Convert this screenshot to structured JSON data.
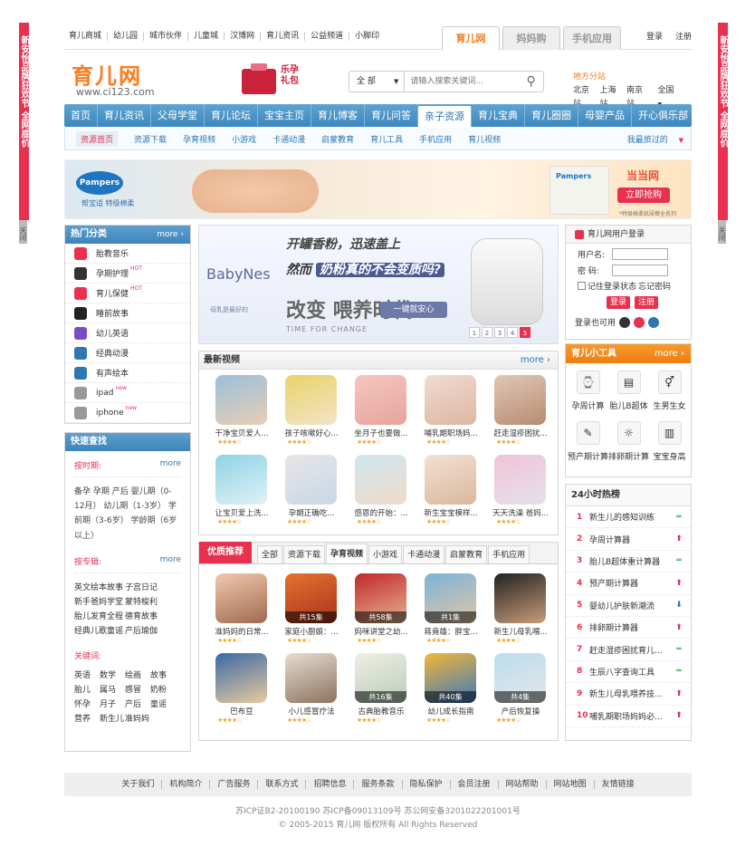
{
  "side_ad": {
    "left_text": "新安怡品牌狂欢节 全网底价",
    "right_text": "新安怡品牌狂欢节 全网底价",
    "close": "关闭"
  },
  "topbar": {
    "links": [
      "育儿商城",
      "幼儿园",
      "城市伙伴",
      "儿童城",
      "汉博网",
      "育儿资讯",
      "公益频道",
      "小脚印"
    ],
    "site_tabs": [
      "育儿网",
      "妈妈购",
      "手机应用"
    ],
    "login": "登录",
    "register": "注册"
  },
  "header": {
    "logo": "育儿网",
    "url": "www.ci123.com",
    "promo": "乐孕礼包",
    "search_select": "全 部",
    "search_placeholder": "请输入搜索关键词...",
    "region_title": "地方分站",
    "cities": [
      "北京站",
      "上海站",
      "南京站",
      "全国"
    ]
  },
  "nav": {
    "items": [
      "首页",
      "育儿资讯",
      "父母学堂",
      "育儿论坛",
      "宝宝主页",
      "育儿博客",
      "育儿问答",
      "亲子资源",
      "育儿宝典",
      "育儿圈圈",
      "母婴产品",
      "开心俱乐部"
    ],
    "active": "亲子资源"
  },
  "subnav": {
    "items": [
      "资源首页",
      "资源下载",
      "孕育视频",
      "小游戏",
      "卡通动漫",
      "启蒙教育",
      "育儿工具",
      "手机应用",
      "育儿视频"
    ],
    "mine": "我最旅过的"
  },
  "banner": {
    "brand": "Pampers",
    "brand_sub": "帮宝适 特级棉柔",
    "shop": "当当网",
    "button": "立即抢购",
    "note": "*特级棉柔纸尿裤全系列"
  },
  "hot_categories": {
    "title": "热门分类",
    "more": "more",
    "items": [
      {
        "label": "胎教音乐",
        "hot": "",
        "color": "#e8304f"
      },
      {
        "label": "孕期护理",
        "hot": "HOT",
        "color": "#333"
      },
      {
        "label": "育儿保健",
        "hot": "HOT",
        "color": "#e8304f"
      },
      {
        "label": "睡前故事",
        "hot": "",
        "color": "#222"
      },
      {
        "label": "幼儿英语",
        "hot": "",
        "color": "#7a4cc4"
      },
      {
        "label": "经典动漫",
        "hot": "",
        "color": "#2d78b3"
      },
      {
        "label": "有声绘本",
        "hot": "",
        "color": "#2d78b3"
      },
      {
        "label": "ipad",
        "hot": "new",
        "color": "#999"
      },
      {
        "label": "iphone",
        "hot": "new",
        "color": "#999"
      }
    ]
  },
  "quick": {
    "title": "快速查找",
    "by_time": "按时期:",
    "more": "more",
    "time_text": "备孕  孕期  产后 婴儿期（0-12月）  幼儿期（1-3岁）  学前期（3-6岁）  学龄期（6岁以上）",
    "by_topic": "按专辑:",
    "topics": [
      "英文绘本故事",
      "子宫日记",
      "新手爸妈学堂",
      "蒙特梭利",
      "胎儿发育全程",
      "德育故事",
      "经典儿歌童谣",
      "产后瑜伽"
    ],
    "by_keyword": "关键词:",
    "keywords": [
      "英语",
      "数学",
      "绘画",
      "故事",
      "胎儿",
      "属马",
      "感冒",
      "奶粉",
      "怀孕",
      "月子",
      "产后",
      "童谣",
      "营养",
      "新生儿",
      "准妈妈"
    ]
  },
  "mid_ad": {
    "line1": "开罐香粉，迅速盖上",
    "line2_a": "然而",
    "line2_b": "奶粉真的不会变质吗?",
    "brand": "BabyNes",
    "brand_sub": "母乳是最好的",
    "change": "改变 喂养时代",
    "change_sub": "TIME FOR CHANGE",
    "button": "一键就安心",
    "pages": [
      "1",
      "2",
      "3",
      "4",
      "5"
    ]
  },
  "videos": {
    "title": "最新视频",
    "more": "more",
    "items": [
      {
        "caption": "干净宝贝爱人...",
        "c1": "#9ac0db",
        "c2": "#e9cdb4"
      },
      {
        "caption": "孩子咳嗽好心...",
        "c1": "#e8d36a",
        "c2": "#f2e4c8"
      },
      {
        "caption": "坐月子也要做...",
        "c1": "#f4c7c0",
        "c2": "#e7a49c"
      },
      {
        "caption": "哺乳期职场妈...",
        "c1": "#f0dcd0",
        "c2": "#ddb6a3"
      },
      {
        "caption": "赶走湿疹困扰...",
        "c1": "#dfc8b6",
        "c2": "#b98b72"
      },
      {
        "caption": "让宝贝爱上洗...",
        "c1": "#8ed3e6",
        "c2": "#e0f1f5"
      },
      {
        "caption": "孕期正确吃...",
        "c1": "#e6e6e6",
        "c2": "#c9d7e6"
      },
      {
        "caption": "感恩的开始：...",
        "c1": "#cfe7f0",
        "c2": "#eedbc8"
      },
      {
        "caption": "新生宝宝模样...",
        "c1": "#f3e1d3",
        "c2": "#d9b89c"
      },
      {
        "caption": "天天洗澡 爸妈...",
        "c1": "#f2c3d6",
        "c2": "#e4e1ec"
      }
    ]
  },
  "recommend": {
    "label": "优质推荐",
    "tabs": [
      "全部",
      "资源下载",
      "孕育视频",
      "小游戏",
      "卡通动漫",
      "启蒙教育",
      "手机应用"
    ],
    "active_tab": "孕育视频",
    "items": [
      {
        "caption": "准妈妈的日常...",
        "ep": "",
        "c1": "#f1c9b0",
        "c2": "#a06a4f"
      },
      {
        "caption": "家庭小厨娘：...",
        "ep": "共15集",
        "c1": "#e4732f",
        "c2": "#a8331b"
      },
      {
        "caption": "妈咪讲堂之幼...",
        "ep": "共58集",
        "c1": "#c0282d",
        "c2": "#e4b48e"
      },
      {
        "caption": "蒋竟雄：胖宝...",
        "ep": "共1集",
        "c1": "#7bb4d6",
        "c2": "#dfc6a9"
      },
      {
        "caption": "新生儿母乳喂...",
        "ep": "",
        "c1": "#222",
        "c2": "#c89d7a"
      },
      {
        "caption": "巴布豆",
        "ep": "",
        "c1": "#3a6aa6",
        "c2": "#e8ca9e"
      },
      {
        "caption": "小儿感冒疗法",
        "ep": "",
        "c1": "#e6ddd2",
        "c2": "#8d735e"
      },
      {
        "caption": "古典胎教音乐",
        "ep": "共16集",
        "c1": "#f0eee6",
        "c2": "#b8cdb7"
      },
      {
        "caption": "幼儿成长指南",
        "ep": "共40集",
        "c1": "#f2b736",
        "c2": "#3c78c0"
      },
      {
        "caption": "产后恢复操",
        "ep": "共4集",
        "c1": "#bcdcef",
        "c2": "#e3e7e8"
      }
    ]
  },
  "login": {
    "title": "育儿网用户登录",
    "username": "用户名:",
    "password": "密  码:",
    "remember": "记住登录状态",
    "forgot": "忘记密码",
    "login_btn": "登录",
    "register_btn": "注册",
    "social": "登录也可用"
  },
  "tools": {
    "title": "育儿小工具",
    "more": "more",
    "items": [
      {
        "label": "孕周计算",
        "icon": "⌚"
      },
      {
        "label": "胎儿B超体",
        "icon": "▤"
      },
      {
        "label": "生男生女",
        "icon": "⚥"
      },
      {
        "label": "预产期计算",
        "icon": "✎"
      },
      {
        "label": "排卵期计算",
        "icon": "☼"
      },
      {
        "label": "宝宝身高",
        "icon": "▥"
      }
    ]
  },
  "hot_list": {
    "title": "24小时热榜",
    "items": [
      {
        "n": "1",
        "t": "新生儿的感知训练",
        "trend": "eq"
      },
      {
        "n": "2",
        "t": "孕周计算器",
        "trend": "up"
      },
      {
        "n": "3",
        "t": "胎儿B超体重计算器",
        "trend": "eq"
      },
      {
        "n": "4",
        "t": "预产期计算器",
        "trend": "up"
      },
      {
        "n": "5",
        "t": "婴幼儿护肤新潮流",
        "trend": "dn"
      },
      {
        "n": "6",
        "t": "排卵期计算器",
        "trend": "up"
      },
      {
        "n": "7",
        "t": "赶走湿疹困扰育儿...",
        "trend": "eq"
      },
      {
        "n": "8",
        "t": "生辰八字查询工具",
        "trend": "eq"
      },
      {
        "n": "9",
        "t": "新生儿母乳喂养技...",
        "trend": "up"
      },
      {
        "n": "10",
        "t": "哺乳期职场妈妈必...",
        "trend": "up"
      }
    ]
  },
  "footer": {
    "links": [
      "关于我们",
      "机构简介",
      "广告服务",
      "联系方式",
      "招聘信息",
      "服务条款",
      "隐私保护",
      "会员注册",
      "网站帮助",
      "网站地图",
      "友情链接"
    ],
    "icp": "苏ICP证B2-20100190    苏ICP备09013109号    苏公网安备3201022201001号",
    "copyright": "© 2005-2015 育儿网 版权所有   All Rights Reserved"
  }
}
